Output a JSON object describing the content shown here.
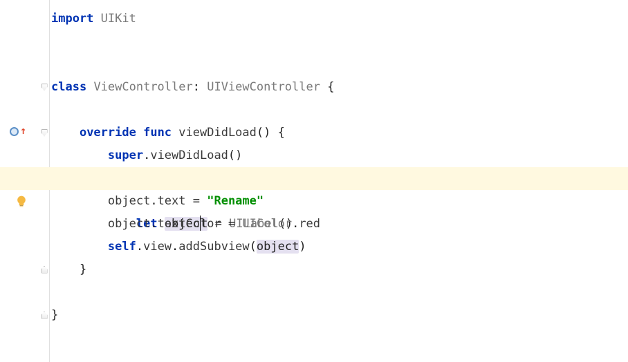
{
  "code": {
    "line1": {
      "kw1": "import",
      "space1": " ",
      "type1": "UIKit"
    },
    "line3": {
      "kw1": "class",
      "space1": " ",
      "type1": "ViewController",
      "plain1": ": ",
      "type2": "UIViewController",
      "plain2": " {"
    },
    "line5": {
      "indent": "    ",
      "kw1": "override",
      "space1": " ",
      "kw2": "func",
      "space2": " ",
      "ident1": "viewDidLoad",
      "plain1": "() {"
    },
    "line6": {
      "indent": "        ",
      "kw1": "super",
      "plain1": ".",
      "ident1": "viewDidLoad",
      "plain2": "()"
    },
    "line7": {
      "indent": "        ",
      "kw1": "let",
      "space1": " ",
      "sel_pre": "objec",
      "sel_post": "t",
      "plain1": " = ",
      "type1": "UILabel",
      "plain2": "()"
    },
    "line8": {
      "indent": "        ",
      "ident1": "object",
      "plain1": ".",
      "ident2": "text",
      "plain2": " = ",
      "str1": "\"Rename\""
    },
    "line9": {
      "indent": "        ",
      "ident1": "object",
      "plain1": ".",
      "ident2": "textColor",
      "plain2": " = ",
      "type1": "UIColor",
      "plain3": ".",
      "ident3": "red"
    },
    "line10": {
      "indent": "        ",
      "kw1": "self",
      "plain1": ".",
      "ident1": "view",
      "plain2": ".",
      "ident2": "addSubview",
      "plain3": "(",
      "sel1": "object",
      "plain4": ")"
    },
    "line11": {
      "indent": "    ",
      "plain1": "}"
    },
    "line13": {
      "plain1": "}"
    },
    "line14": {
      "plain1": ""
    }
  },
  "gutter": {
    "override_icon": "override-up",
    "bulb_icon": "lightbulb"
  }
}
